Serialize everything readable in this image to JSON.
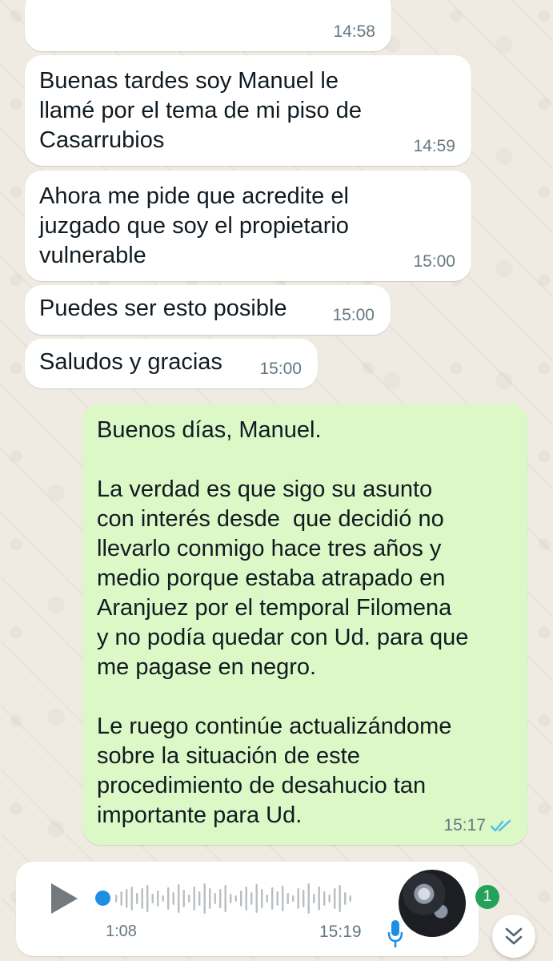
{
  "messages": [
    {
      "text": "",
      "time": "14:58"
    },
    {
      "text": "Buenas tardes soy Manuel le\nllamé por el tema de mi piso de\nCasarrubios",
      "time": "14:59"
    },
    {
      "text": "Ahora me pide que acredite el\njuzgado que soy el propietario\nvulnerable",
      "time": "15:00"
    },
    {
      "text": "Puedes ser esto posible",
      "time": "15:00"
    },
    {
      "text": "Saludos y gracias",
      "time": "15:00"
    },
    {
      "text": "Buenos días, Manuel.\n\nLa verdad es que sigo su asunto\ncon interés desde  que decidió no\nllevarlo conmigo hace tres años y\nmedio porque estaba atrapado en\nAranjuez por el temporal Filomena\ny no podía quedar con Ud. para que\nme pagase en negro.\n\nLe ruego continúe actualizándome\nsobre la situación de este\nprocedimiento de desahucio tan\nimportante para Ud.",
      "time": "15:17",
      "status": "read"
    }
  ],
  "voice_note": {
    "duration": "1:08",
    "time": "15:19",
    "progress": 0
  },
  "unread_badge": "1",
  "icons": {
    "play": "play-icon",
    "microphone": "microphone-icon",
    "scroll_down": "double-chevron-down-icon",
    "read_receipt": "double-check-icon"
  },
  "colors": {
    "incoming_bubble": "#ffffff",
    "outgoing_bubble": "#dcf8c6",
    "read_receipt": "#53bdeb",
    "voice_accent": "#1c8fe3",
    "badge": "#25a25a"
  }
}
